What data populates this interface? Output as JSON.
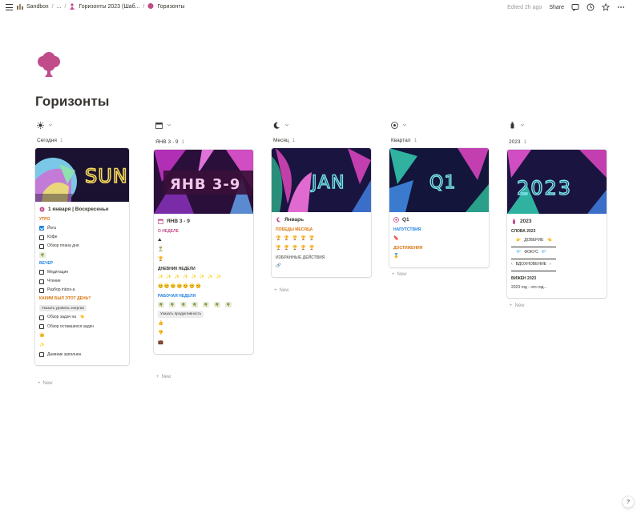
{
  "topbar": {
    "crumbs": [
      "Sandbox",
      "...",
      "Горизонты 2023 (Шаб...",
      "Горизонты"
    ],
    "edited": "Edited 2h ago",
    "share": "Share"
  },
  "page": {
    "title": "Горизонты"
  },
  "colors": {
    "accent": "#2383e2",
    "pink": "#c14c8a",
    "orange": "#d9730d"
  },
  "columns": [
    {
      "group": "Сегодня",
      "count": "1",
      "cover_text": "SUN",
      "card_title": "1 января | Воскресенье",
      "s1": "УТРО",
      "items1": [
        "Йога",
        "Кофе",
        "Обзор плана дня"
      ],
      "s2": "ВЕЧЕР",
      "items2": [
        "Медитация",
        "Чтение",
        "Разбор inbox-а"
      ],
      "s3": "КАКИМ БЫЛ ЭТОТ ДЕНЬ?",
      "tag": "Указать уровень энергии",
      "items3": [
        "Обзор задач на",
        "Обзор оставшихся задач"
      ],
      "item_last": "Дневник заполнен",
      "new": "New"
    },
    {
      "group": "ЯНВ 3 - 9",
      "count": "1",
      "cover_text": "ЯНВ 3-9",
      "card_title": "ЯНВ 3 - 9",
      "s1": "О НЕДЕЛЕ",
      "s2": "ДНЕВНИК НЕДЕЛИ",
      "s3": "РАБОЧАЯ НЕДЕЛЯ",
      "tag": "Указать продуктивность",
      "new": "New"
    },
    {
      "group": "Месяц",
      "count": "1",
      "cover_text": "JAN",
      "card_title": "Январь",
      "s1": "ПОБЕДЫ МЕСЯЦА",
      "s2": "ИЗБРАННЫЕ ДЕЙСТВИЯ",
      "new": "New"
    },
    {
      "group": "Квартал",
      "count": "1",
      "cover_text": "Q1",
      "card_title": "Q1",
      "s1": "НАПУТСТВИЯ",
      "s2": "ДОСТИЖЕНИЯ",
      "new": "New"
    },
    {
      "group": "2023",
      "count": "1",
      "cover_text": "2023",
      "card_title": "2023",
      "s1": "СЛОВА 2023",
      "w1": "ДОВЕРИЕ",
      "w2": "ФОКУС",
      "w3": "ВДОХНОВЕНИЕ",
      "s2": "ВИЖЕН 2023",
      "vision": "2023 год - это год...",
      "new": "New"
    }
  ],
  "help": "?"
}
